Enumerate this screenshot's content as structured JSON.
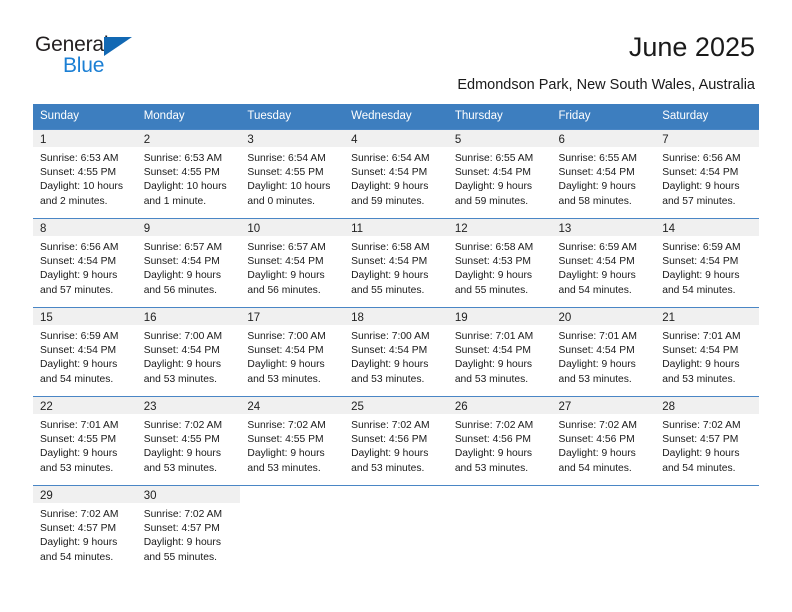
{
  "brand": {
    "name_part1": "General",
    "name_part2": "Blue",
    "accent_color": "#1b7fd4",
    "triangle_color": "#1268b3"
  },
  "header": {
    "title": "June 2025",
    "location": "Edmondson Park, New South Wales, Australia"
  },
  "calendar": {
    "header_color": "#3d7ebf",
    "weekdays": [
      "Sunday",
      "Monday",
      "Tuesday",
      "Wednesday",
      "Thursday",
      "Friday",
      "Saturday"
    ],
    "labels": {
      "sunrise": "Sunrise:",
      "sunset": "Sunset:",
      "daylight": "Daylight:"
    },
    "weeks": [
      [
        {
          "day": "1",
          "sunrise": "Sunrise: 6:53 AM",
          "sunset": "Sunset: 4:55 PM",
          "daylight_line1": "Daylight: 10 hours",
          "daylight_line2": "and 2 minutes."
        },
        {
          "day": "2",
          "sunrise": "Sunrise: 6:53 AM",
          "sunset": "Sunset: 4:55 PM",
          "daylight_line1": "Daylight: 10 hours",
          "daylight_line2": "and 1 minute."
        },
        {
          "day": "3",
          "sunrise": "Sunrise: 6:54 AM",
          "sunset": "Sunset: 4:55 PM",
          "daylight_line1": "Daylight: 10 hours",
          "daylight_line2": "and 0 minutes."
        },
        {
          "day": "4",
          "sunrise": "Sunrise: 6:54 AM",
          "sunset": "Sunset: 4:54 PM",
          "daylight_line1": "Daylight: 9 hours",
          "daylight_line2": "and 59 minutes."
        },
        {
          "day": "5",
          "sunrise": "Sunrise: 6:55 AM",
          "sunset": "Sunset: 4:54 PM",
          "daylight_line1": "Daylight: 9 hours",
          "daylight_line2": "and 59 minutes."
        },
        {
          "day": "6",
          "sunrise": "Sunrise: 6:55 AM",
          "sunset": "Sunset: 4:54 PM",
          "daylight_line1": "Daylight: 9 hours",
          "daylight_line2": "and 58 minutes."
        },
        {
          "day": "7",
          "sunrise": "Sunrise: 6:56 AM",
          "sunset": "Sunset: 4:54 PM",
          "daylight_line1": "Daylight: 9 hours",
          "daylight_line2": "and 57 minutes."
        }
      ],
      [
        {
          "day": "8",
          "sunrise": "Sunrise: 6:56 AM",
          "sunset": "Sunset: 4:54 PM",
          "daylight_line1": "Daylight: 9 hours",
          "daylight_line2": "and 57 minutes."
        },
        {
          "day": "9",
          "sunrise": "Sunrise: 6:57 AM",
          "sunset": "Sunset: 4:54 PM",
          "daylight_line1": "Daylight: 9 hours",
          "daylight_line2": "and 56 minutes."
        },
        {
          "day": "10",
          "sunrise": "Sunrise: 6:57 AM",
          "sunset": "Sunset: 4:54 PM",
          "daylight_line1": "Daylight: 9 hours",
          "daylight_line2": "and 56 minutes."
        },
        {
          "day": "11",
          "sunrise": "Sunrise: 6:58 AM",
          "sunset": "Sunset: 4:54 PM",
          "daylight_line1": "Daylight: 9 hours",
          "daylight_line2": "and 55 minutes."
        },
        {
          "day": "12",
          "sunrise": "Sunrise: 6:58 AM",
          "sunset": "Sunset: 4:53 PM",
          "daylight_line1": "Daylight: 9 hours",
          "daylight_line2": "and 55 minutes."
        },
        {
          "day": "13",
          "sunrise": "Sunrise: 6:59 AM",
          "sunset": "Sunset: 4:54 PM",
          "daylight_line1": "Daylight: 9 hours",
          "daylight_line2": "and 54 minutes."
        },
        {
          "day": "14",
          "sunrise": "Sunrise: 6:59 AM",
          "sunset": "Sunset: 4:54 PM",
          "daylight_line1": "Daylight: 9 hours",
          "daylight_line2": "and 54 minutes."
        }
      ],
      [
        {
          "day": "15",
          "sunrise": "Sunrise: 6:59 AM",
          "sunset": "Sunset: 4:54 PM",
          "daylight_line1": "Daylight: 9 hours",
          "daylight_line2": "and 54 minutes."
        },
        {
          "day": "16",
          "sunrise": "Sunrise: 7:00 AM",
          "sunset": "Sunset: 4:54 PM",
          "daylight_line1": "Daylight: 9 hours",
          "daylight_line2": "and 53 minutes."
        },
        {
          "day": "17",
          "sunrise": "Sunrise: 7:00 AM",
          "sunset": "Sunset: 4:54 PM",
          "daylight_line1": "Daylight: 9 hours",
          "daylight_line2": "and 53 minutes."
        },
        {
          "day": "18",
          "sunrise": "Sunrise: 7:00 AM",
          "sunset": "Sunset: 4:54 PM",
          "daylight_line1": "Daylight: 9 hours",
          "daylight_line2": "and 53 minutes."
        },
        {
          "day": "19",
          "sunrise": "Sunrise: 7:01 AM",
          "sunset": "Sunset: 4:54 PM",
          "daylight_line1": "Daylight: 9 hours",
          "daylight_line2": "and 53 minutes."
        },
        {
          "day": "20",
          "sunrise": "Sunrise: 7:01 AM",
          "sunset": "Sunset: 4:54 PM",
          "daylight_line1": "Daylight: 9 hours",
          "daylight_line2": "and 53 minutes."
        },
        {
          "day": "21",
          "sunrise": "Sunrise: 7:01 AM",
          "sunset": "Sunset: 4:54 PM",
          "daylight_line1": "Daylight: 9 hours",
          "daylight_line2": "and 53 minutes."
        }
      ],
      [
        {
          "day": "22",
          "sunrise": "Sunrise: 7:01 AM",
          "sunset": "Sunset: 4:55 PM",
          "daylight_line1": "Daylight: 9 hours",
          "daylight_line2": "and 53 minutes."
        },
        {
          "day": "23",
          "sunrise": "Sunrise: 7:02 AM",
          "sunset": "Sunset: 4:55 PM",
          "daylight_line1": "Daylight: 9 hours",
          "daylight_line2": "and 53 minutes."
        },
        {
          "day": "24",
          "sunrise": "Sunrise: 7:02 AM",
          "sunset": "Sunset: 4:55 PM",
          "daylight_line1": "Daylight: 9 hours",
          "daylight_line2": "and 53 minutes."
        },
        {
          "day": "25",
          "sunrise": "Sunrise: 7:02 AM",
          "sunset": "Sunset: 4:56 PM",
          "daylight_line1": "Daylight: 9 hours",
          "daylight_line2": "and 53 minutes."
        },
        {
          "day": "26",
          "sunrise": "Sunrise: 7:02 AM",
          "sunset": "Sunset: 4:56 PM",
          "daylight_line1": "Daylight: 9 hours",
          "daylight_line2": "and 53 minutes."
        },
        {
          "day": "27",
          "sunrise": "Sunrise: 7:02 AM",
          "sunset": "Sunset: 4:56 PM",
          "daylight_line1": "Daylight: 9 hours",
          "daylight_line2": "and 54 minutes."
        },
        {
          "day": "28",
          "sunrise": "Sunrise: 7:02 AM",
          "sunset": "Sunset: 4:57 PM",
          "daylight_line1": "Daylight: 9 hours",
          "daylight_line2": "and 54 minutes."
        }
      ],
      [
        {
          "day": "29",
          "sunrise": "Sunrise: 7:02 AM",
          "sunset": "Sunset: 4:57 PM",
          "daylight_line1": "Daylight: 9 hours",
          "daylight_line2": "and 54 minutes."
        },
        {
          "day": "30",
          "sunrise": "Sunrise: 7:02 AM",
          "sunset": "Sunset: 4:57 PM",
          "daylight_line1": "Daylight: 9 hours",
          "daylight_line2": "and 55 minutes."
        },
        {
          "day": "",
          "sunrise": "",
          "sunset": "",
          "daylight_line1": "",
          "daylight_line2": ""
        },
        {
          "day": "",
          "sunrise": "",
          "sunset": "",
          "daylight_line1": "",
          "daylight_line2": ""
        },
        {
          "day": "",
          "sunrise": "",
          "sunset": "",
          "daylight_line1": "",
          "daylight_line2": ""
        },
        {
          "day": "",
          "sunrise": "",
          "sunset": "",
          "daylight_line1": "",
          "daylight_line2": ""
        },
        {
          "day": "",
          "sunrise": "",
          "sunset": "",
          "daylight_line1": "",
          "daylight_line2": ""
        }
      ]
    ]
  }
}
